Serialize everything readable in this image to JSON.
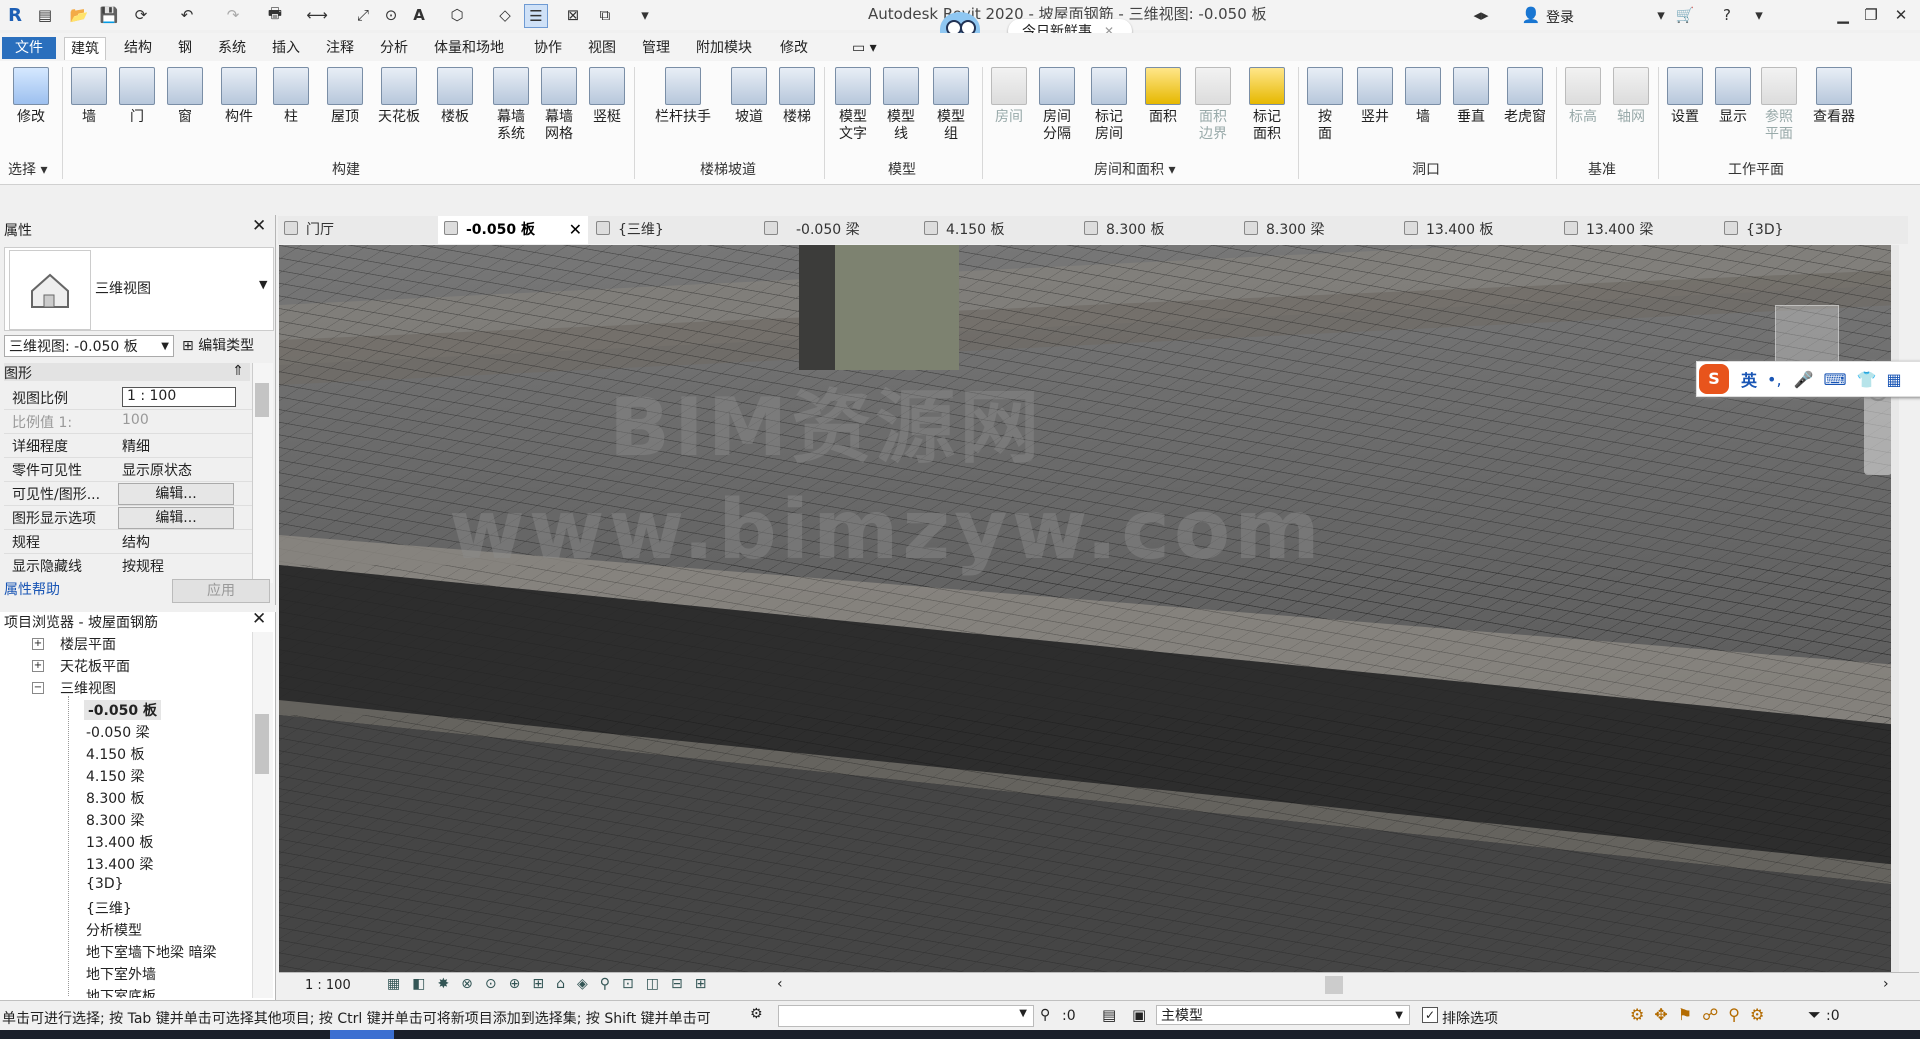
{
  "title": "Autodesk Revit 2020 -  坡屋面钢筋 - 三维视图: -0.050 板",
  "login_label": "登录",
  "news_label": "今日新鲜事",
  "tabs": [
    "文件",
    "建筑",
    "结构",
    "钢",
    "系统",
    "插入",
    "注释",
    "分析",
    "体量和场地",
    "协作",
    "视图",
    "管理",
    "附加模块",
    "修改"
  ],
  "ribbon_buttons": [
    {
      "label": "修改"
    },
    {
      "label": "墙"
    },
    {
      "label": "门"
    },
    {
      "label": "窗"
    },
    {
      "label": "构件"
    },
    {
      "label": "柱"
    },
    {
      "label": "屋顶"
    },
    {
      "label": "天花板"
    },
    {
      "label": "楼板"
    },
    {
      "label": "幕墙\n系统"
    },
    {
      "label": "幕墙\n网格"
    },
    {
      "label": "竖梃"
    },
    {
      "label": "栏杆扶手"
    },
    {
      "label": "坡道"
    },
    {
      "label": "楼梯"
    },
    {
      "label": "模型\n文字"
    },
    {
      "label": "模型\n线"
    },
    {
      "label": "模型\n组"
    },
    {
      "label": "房间"
    },
    {
      "label": "房间\n分隔"
    },
    {
      "label": "标记\n房间"
    },
    {
      "label": "面积"
    },
    {
      "label": "面积\n边界"
    },
    {
      "label": "标记\n面积"
    },
    {
      "label": "按\n面"
    },
    {
      "label": "竖井"
    },
    {
      "label": "墙"
    },
    {
      "label": "垂直"
    },
    {
      "label": "老虎窗"
    },
    {
      "label": "标高"
    },
    {
      "label": "轴网"
    },
    {
      "label": "设置"
    },
    {
      "label": "显示"
    },
    {
      "label": "参照\n平面"
    },
    {
      "label": "查看器"
    }
  ],
  "panels": [
    "选择",
    "构建",
    "楼梯坡道",
    "模型",
    "房间和面积",
    "洞口",
    "基准",
    "工作平面"
  ],
  "properties": {
    "header": "属性",
    "type_name": "三维视图",
    "view_selector": "三维视图: -0.050 板",
    "edit_type": "编辑类型",
    "section": "图形",
    "rows": [
      {
        "key": "视图比例",
        "value": "1 : 100"
      },
      {
        "key": "比例值 1:",
        "value": "100"
      },
      {
        "key": "详细程度",
        "value": "精细"
      },
      {
        "key": "零件可见性",
        "value": "显示原状态"
      },
      {
        "key": "可见性/图形...",
        "value": "编辑..."
      },
      {
        "key": "图形显示选项",
        "value": "编辑..."
      },
      {
        "key": "规程",
        "value": "结构"
      },
      {
        "key": "显示隐藏线",
        "value": "按规程"
      }
    ],
    "help": "属性帮助",
    "apply": "应用"
  },
  "browser": {
    "header": "项目浏览器 - 坡屋面钢筋",
    "items": [
      {
        "label": "楼层平面"
      },
      {
        "label": "天花板平面"
      },
      {
        "label": "三维视图"
      },
      {
        "label": "-0.050 板"
      },
      {
        "label": "-0.050 梁"
      },
      {
        "label": "4.150 板"
      },
      {
        "label": "4.150 梁"
      },
      {
        "label": "8.300 板"
      },
      {
        "label": "8.300 梁"
      },
      {
        "label": "13.400 板"
      },
      {
        "label": "13.400 梁"
      },
      {
        "label": "{3D}"
      },
      {
        "label": "{三维}"
      },
      {
        "label": "分析模型"
      },
      {
        "label": "地下室墙下地梁 暗梁"
      },
      {
        "label": "地下室外墙"
      },
      {
        "label": "地下室底板"
      }
    ]
  },
  "view_tabs": [
    "门厅",
    "-0.050 板",
    "{三维}",
    "-0.050 梁",
    "4.150 板",
    "8.300 板",
    "8.300 梁",
    "13.400 板",
    "13.400 梁",
    "{3D}"
  ],
  "watermark": {
    "line1": "BIM资源网",
    "line2": "www.bimzyw.com"
  },
  "ime": {
    "lang": "英"
  },
  "viewbar_scale": "1 : 100",
  "status": {
    "hint": "单击可进行选择; 按 Tab 键并单击可选择其他项目; 按 Ctrl 键并单击可将新项目添加到选择集; 按 Shift 键并单击可",
    "count1": ":0",
    "model": "主模型",
    "exclude": "排除选项",
    "filter": ":0"
  }
}
